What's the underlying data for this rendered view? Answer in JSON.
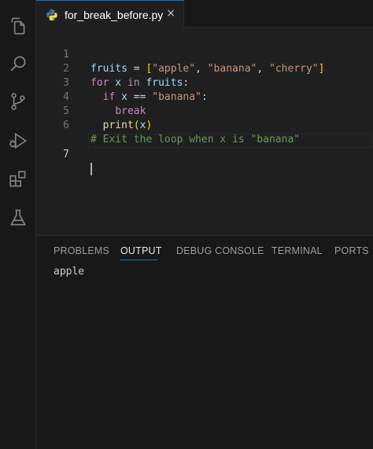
{
  "activity_bar": {
    "icons": [
      "files-icon",
      "search-icon",
      "source-control-icon",
      "run-debug-icon",
      "extensions-icon",
      "testing-icon"
    ]
  },
  "tab": {
    "filename": "for_break_before.py",
    "close_glyph": "×"
  },
  "editor": {
    "line_numbers": [
      "1",
      "2",
      "3",
      "4",
      "5",
      "6",
      "7"
    ],
    "active_line": 7
  },
  "code": {
    "l1": {
      "var": "fruits",
      "eq": " = ",
      "lb": "[",
      "s1": "\"apple\"",
      "c1": ", ",
      "s2": "\"banana\"",
      "c2": ", ",
      "s3": "\"cherry\"",
      "rb": "]"
    },
    "l2": {
      "kw_for": "for",
      "x": " x ",
      "kw_in": "in",
      "fruits": " fruits",
      "colon": ":"
    },
    "l3": {
      "indent": "  ",
      "kw_if": "if",
      "x": " x ",
      "op": "==",
      "str": " \"banana\"",
      "colon": ":"
    },
    "l4": {
      "indent": "    ",
      "kw_break": "break"
    },
    "l5": {
      "indent": "  ",
      "fn": "print",
      "lp": "(",
      "arg": "x",
      "rp": ")"
    },
    "l6": {
      "comment": "# Exit the loop when x is \"banana\""
    }
  },
  "panel": {
    "tabs": [
      "PROBLEMS",
      "OUTPUT",
      "DEBUG CONSOLE",
      "TERMINAL",
      "PORTS"
    ],
    "active_tab": "OUTPUT",
    "output": "apple"
  }
}
